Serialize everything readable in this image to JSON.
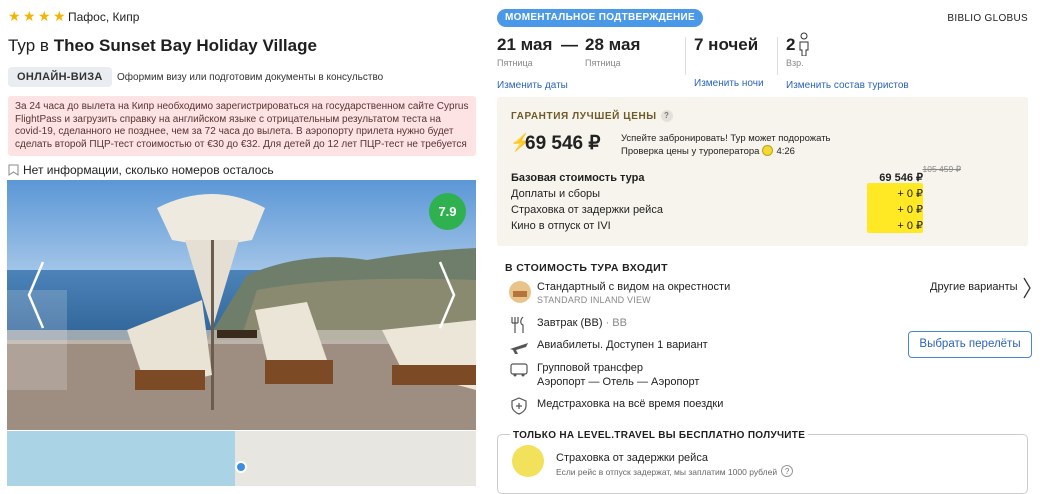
{
  "hotel": {
    "stars": 4,
    "location": "Пафос, Кипр",
    "title_prefix": "Тур в",
    "title_name": "Theo Sunset Bay Holiday Village",
    "visa_badge": "ОНЛАЙН-ВИЗА",
    "visa_text": "Оформим визу или подготовим документы в консульство",
    "warning": "За 24 часа до вылета на Кипр необходимо зарегистрироваться на государственном сайте Cyprus FlightPass и загрузить справку на английском языке с отрицательным результатом теста на covid-19, сделанного не позднее, чем за 72 часа до вылета. В аэропорту прилета нужно будет сделать второй ПЦР-тест стоимостью от €30 до €32. Для детей до 12 лет ПЦР-тест не требуется",
    "rooms_info": "Нет информации, сколько номеров осталось",
    "rating": "7.9"
  },
  "booking": {
    "instant_badge": "МОМЕНТАЛЬНОЕ ПОДТВЕРЖДЕНИЕ",
    "operator": "BIBLIO GLOBUS",
    "date_from": "21 мая",
    "date_from_day": "Пятница",
    "date_to": "28 мая",
    "date_to_day": "Пятница",
    "change_dates": "Изменить даты",
    "nights": "7 ночей",
    "change_nights": "Изменить ночи",
    "tourists": "2",
    "tourists_sub": "Взр.",
    "change_tourists": "Изменить состав туристов"
  },
  "guarantee": {
    "title": "ГАРАНТИЯ ЛУЧШЕЙ ЦЕНЫ",
    "price": "69 546 ₽",
    "hurry_line1": "Успейте забронировать! Тур может подорожать",
    "hurry_line2": "Проверка цены у туроператора",
    "timer": "4:26",
    "old_price": "105 459 ₽",
    "rows": [
      {
        "label": "Базовая стоимость тура",
        "value": "69 546 ₽"
      },
      {
        "label": "Доплаты и сборы",
        "value": "+ 0 ₽"
      },
      {
        "label": "Страховка от задержки рейса",
        "value": "+ 0 ₽"
      },
      {
        "label": "Кино в отпуск от IVI",
        "value": "+ 0 ₽"
      }
    ]
  },
  "included": {
    "title": "В СТОИМОСТЬ ТУРА ВХОДИТ",
    "room": "Стандартный с видом на окрестности",
    "room_sub": "STANDARD INLAND VIEW",
    "other_variants": "Другие варианты",
    "meal": "Завтрак (BB)",
    "meal_sub": "· BB",
    "flights": "Авиабилеты. Доступен 1 вариант",
    "choose_flights": "Выбрать перелёты",
    "transfer": "Групповой трансфер",
    "transfer_route": "Аэропорт — Отель — Аэропорт",
    "insurance": "Медстраховка на всё время поездки"
  },
  "free": {
    "title": "ТОЛЬКО НА LEVEL.TRAVEL ВЫ БЕСПЛАТНО ПОЛУЧИТЕ",
    "item_title": "Страховка от задержки рейса",
    "item_sub": "Если рейс в отпуск задержат, мы заплатим 1000 рублей"
  }
}
